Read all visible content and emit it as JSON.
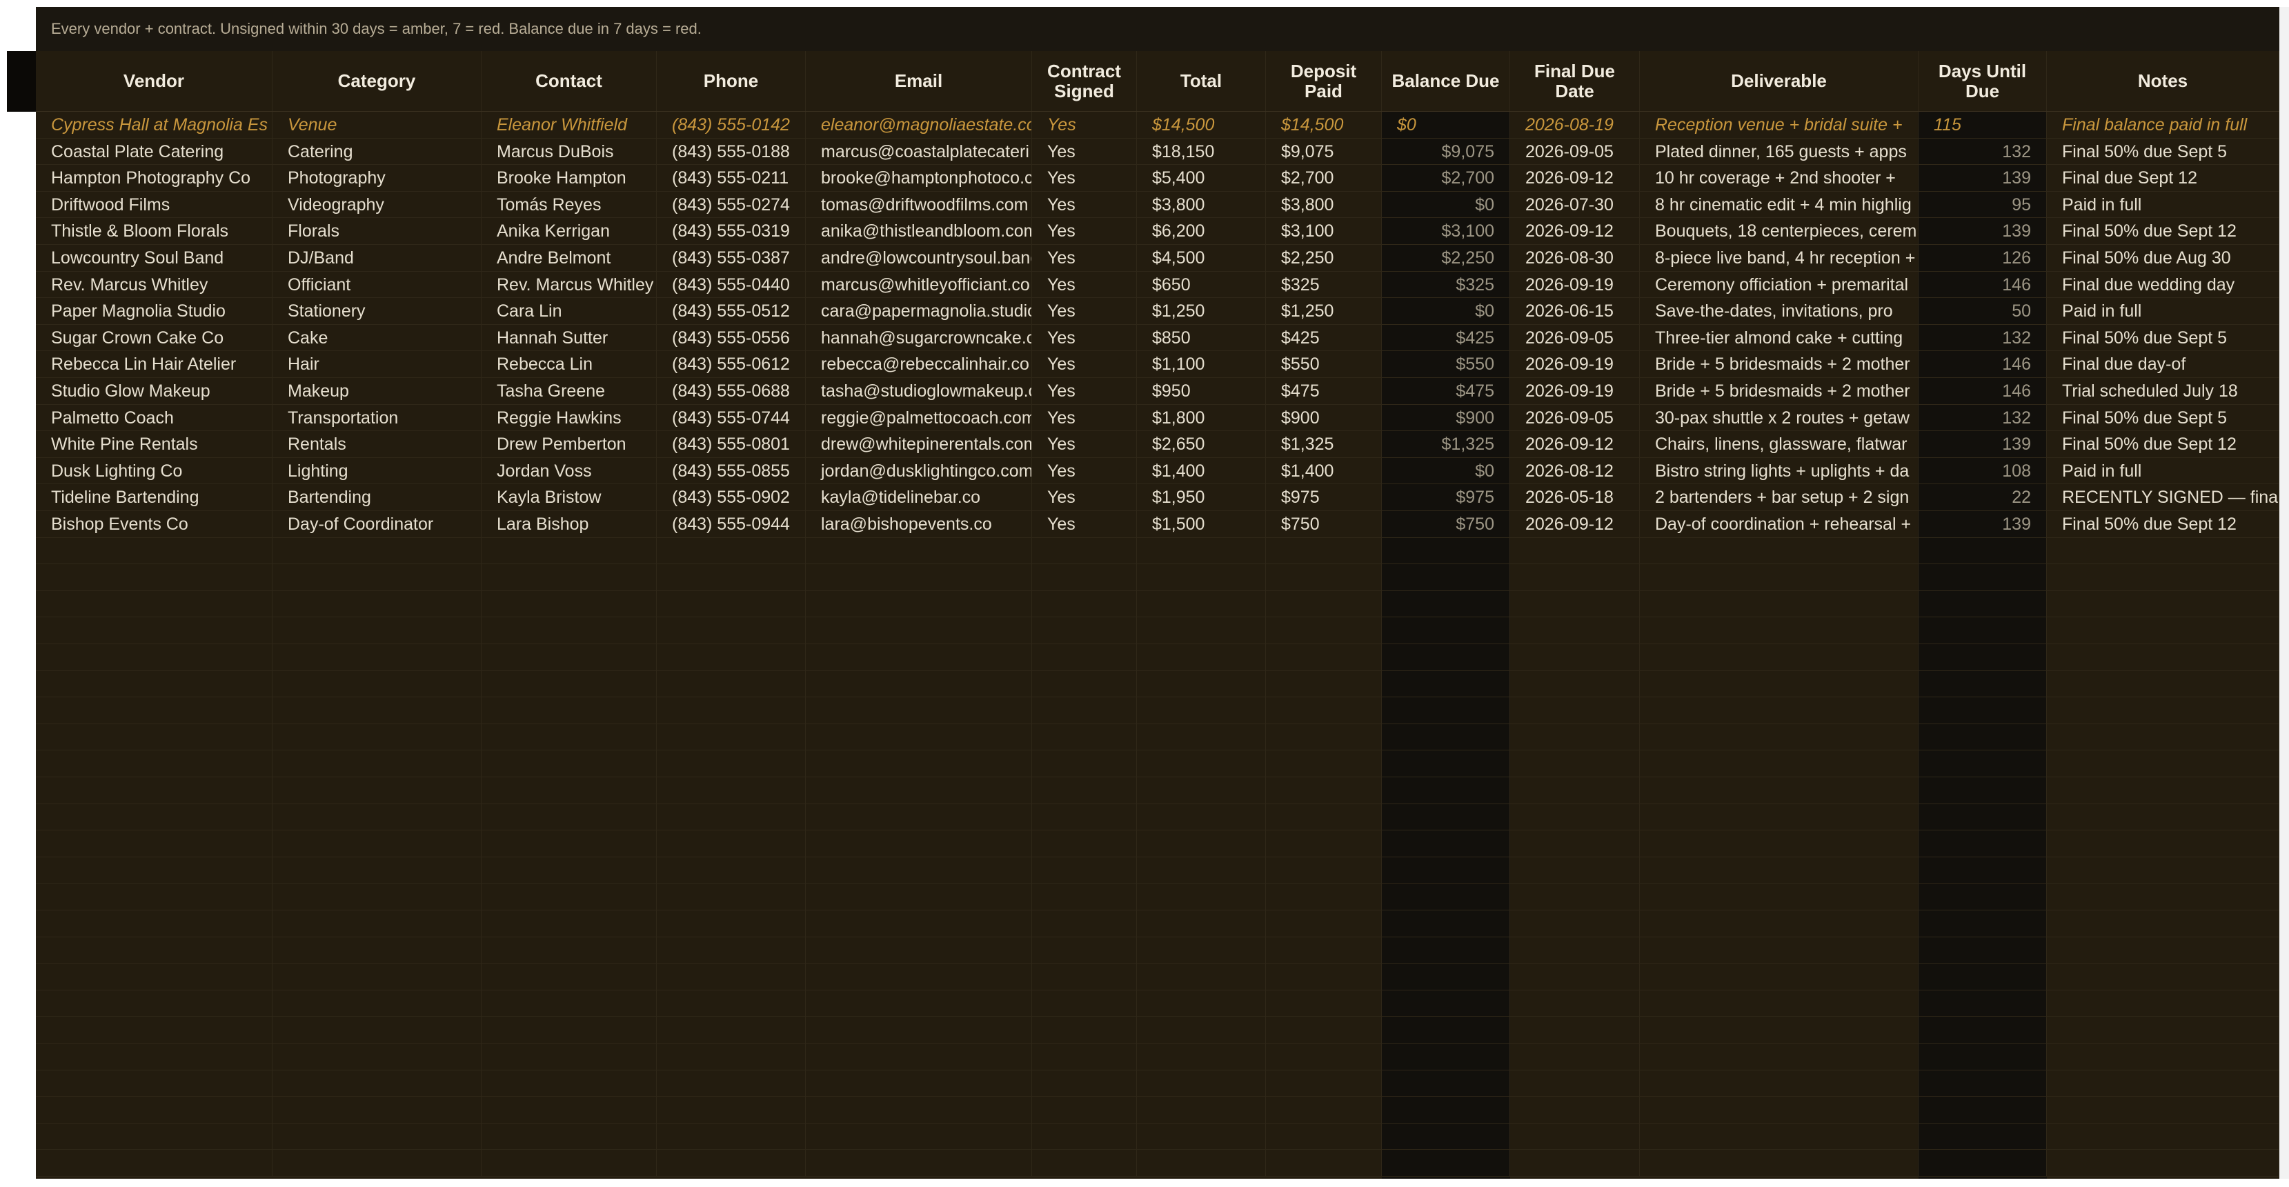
{
  "banner": "Every vendor + contract. Unsigned within 30 days = amber, 7 = red. Balance due in 7 days = red.",
  "columns": [
    {
      "label": "Vendor"
    },
    {
      "label": "Category"
    },
    {
      "label": "Contact"
    },
    {
      "label": "Phone"
    },
    {
      "label": "Email"
    },
    {
      "label": "Contract\nSigned"
    },
    {
      "label": "Total"
    },
    {
      "label": "Deposit Paid"
    },
    {
      "label": "Balance Due"
    },
    {
      "label": "Final Due Date"
    },
    {
      "label": "Deliverable"
    },
    {
      "label": "Days Until\nDue"
    },
    {
      "label": "Notes"
    }
  ],
  "rows": [
    {
      "vendor": "Cypress Hall at Magnolia Es",
      "category": "Venue",
      "contact": "Eleanor Whitfield",
      "phone": "(843) 555-0142",
      "email": "eleanor@magnoliaestate.co",
      "signed": "Yes",
      "total": "$14,500",
      "deposit": "$14,500",
      "balance": "$0",
      "due_date": "2026-08-19",
      "deliverable": "Reception venue + bridal suite +",
      "days": "115",
      "notes": "Final balance paid in full",
      "featured": true
    },
    {
      "vendor": "Coastal Plate Catering",
      "category": "Catering",
      "contact": "Marcus DuBois",
      "phone": "(843) 555-0188",
      "email": "marcus@coastalplatecateri",
      "signed": "Yes",
      "total": "$18,150",
      "deposit": "$9,075",
      "balance": "$9,075",
      "due_date": "2026-09-05",
      "deliverable": "Plated dinner, 165 guests + apps",
      "days": "132",
      "notes": "Final 50% due Sept 5"
    },
    {
      "vendor": "Hampton Photography Co",
      "category": "Photography",
      "contact": "Brooke Hampton",
      "phone": "(843) 555-0211",
      "email": "brooke@hamptonphotoco.c",
      "signed": "Yes",
      "total": "$5,400",
      "deposit": "$2,700",
      "balance": "$2,700",
      "due_date": "2026-09-12",
      "deliverable": "10 hr coverage + 2nd shooter +",
      "days": "139",
      "notes": "Final due Sept 12"
    },
    {
      "vendor": "Driftwood Films",
      "category": "Videography",
      "contact": "Tomás Reyes",
      "phone": "(843) 555-0274",
      "email": "tomas@driftwoodfilms.com",
      "signed": "Yes",
      "total": "$3,800",
      "deposit": "$3,800",
      "balance": "$0",
      "due_date": "2026-07-30",
      "deliverable": "8 hr cinematic edit + 4 min highlig",
      "days": "95",
      "notes": "Paid in full"
    },
    {
      "vendor": "Thistle & Bloom Florals",
      "category": "Florals",
      "contact": "Anika Kerrigan",
      "phone": "(843) 555-0319",
      "email": "anika@thistleandbloom.com",
      "signed": "Yes",
      "total": "$6,200",
      "deposit": "$3,100",
      "balance": "$3,100",
      "due_date": "2026-09-12",
      "deliverable": "Bouquets, 18 centerpieces, cerem",
      "days": "139",
      "notes": "Final 50% due Sept 12"
    },
    {
      "vendor": "Lowcountry Soul Band",
      "category": "DJ/Band",
      "contact": "Andre Belmont",
      "phone": "(843) 555-0387",
      "email": "andre@lowcountrysoul.banc",
      "signed": "Yes",
      "total": "$4,500",
      "deposit": "$2,250",
      "balance": "$2,250",
      "due_date": "2026-08-30",
      "deliverable": "8-piece live band, 4 hr reception +",
      "days": "126",
      "notes": "Final 50% due Aug 30"
    },
    {
      "vendor": "Rev. Marcus Whitley",
      "category": "Officiant",
      "contact": "Rev. Marcus Whitley",
      "phone": "(843) 555-0440",
      "email": "marcus@whitleyofficiant.co",
      "signed": "Yes",
      "total": "$650",
      "deposit": "$325",
      "balance": "$325",
      "due_date": "2026-09-19",
      "deliverable": "Ceremony officiation + premarital",
      "days": "146",
      "notes": "Final due wedding day"
    },
    {
      "vendor": "Paper Magnolia Studio",
      "category": "Stationery",
      "contact": "Cara Lin",
      "phone": "(843) 555-0512",
      "email": "cara@papermagnolia.studio",
      "signed": "Yes",
      "total": "$1,250",
      "deposit": "$1,250",
      "balance": "$0",
      "due_date": "2026-06-15",
      "deliverable": "Save-the-dates, invitations, pro",
      "days": "50",
      "notes": "Paid in full"
    },
    {
      "vendor": "Sugar Crown Cake Co",
      "category": "Cake",
      "contact": "Hannah Sutter",
      "phone": "(843) 555-0556",
      "email": "hannah@sugarcrowncake.c",
      "signed": "Yes",
      "total": "$850",
      "deposit": "$425",
      "balance": "$425",
      "due_date": "2026-09-05",
      "deliverable": "Three-tier almond cake + cutting",
      "days": "132",
      "notes": "Final 50% due Sept 5"
    },
    {
      "vendor": "Rebecca Lin Hair Atelier",
      "category": "Hair",
      "contact": "Rebecca Lin",
      "phone": "(843) 555-0612",
      "email": "rebecca@rebeccalinhair.co",
      "signed": "Yes",
      "total": "$1,100",
      "deposit": "$550",
      "balance": "$550",
      "due_date": "2026-09-19",
      "deliverable": "Bride + 5 bridesmaids + 2 mother",
      "days": "146",
      "notes": "Final due day-of"
    },
    {
      "vendor": "Studio Glow Makeup",
      "category": "Makeup",
      "contact": "Tasha Greene",
      "phone": "(843) 555-0688",
      "email": "tasha@studioglowmakeup.c",
      "signed": "Yes",
      "total": "$950",
      "deposit": "$475",
      "balance": "$475",
      "due_date": "2026-09-19",
      "deliverable": "Bride + 5 bridesmaids + 2 mother",
      "days": "146",
      "notes": "Trial scheduled July 18"
    },
    {
      "vendor": "Palmetto Coach",
      "category": "Transportation",
      "contact": "Reggie Hawkins",
      "phone": "(843) 555-0744",
      "email": "reggie@palmettocoach.com",
      "signed": "Yes",
      "total": "$1,800",
      "deposit": "$900",
      "balance": "$900",
      "due_date": "2026-09-05",
      "deliverable": "30-pax shuttle x 2 routes + getaw",
      "days": "132",
      "notes": "Final 50% due Sept 5"
    },
    {
      "vendor": "White Pine Rentals",
      "category": "Rentals",
      "contact": "Drew Pemberton",
      "phone": "(843) 555-0801",
      "email": "drew@whitepinerentals.com",
      "signed": "Yes",
      "total": "$2,650",
      "deposit": "$1,325",
      "balance": "$1,325",
      "due_date": "2026-09-12",
      "deliverable": "Chairs, linens, glassware, flatwar",
      "days": "139",
      "notes": "Final 50% due Sept 12"
    },
    {
      "vendor": "Dusk Lighting Co",
      "category": "Lighting",
      "contact": "Jordan Voss",
      "phone": "(843) 555-0855",
      "email": "jordan@dusklightingco.com",
      "signed": "Yes",
      "total": "$1,400",
      "deposit": "$1,400",
      "balance": "$0",
      "due_date": "2026-08-12",
      "deliverable": "Bistro string lights + uplights + da",
      "days": "108",
      "notes": "Paid in full"
    },
    {
      "vendor": "Tideline Bartending",
      "category": "Bartending",
      "contact": "Kayla Bristow",
      "phone": "(843) 555-0902",
      "email": "kayla@tidelinebar.co",
      "signed": "Yes",
      "total": "$1,950",
      "deposit": "$975",
      "balance": "$975",
      "due_date": "2026-05-18",
      "deliverable": "2 bartenders + bar setup + 2 sign",
      "days": "22",
      "notes": "RECENTLY SIGNED — fina"
    },
    {
      "vendor": "Bishop Events Co",
      "category": "Day-of Coordinator",
      "contact": "Lara Bishop",
      "phone": "(843) 555-0944",
      "email": "lara@bishopevents.co",
      "signed": "Yes",
      "total": "$1,500",
      "deposit": "$750",
      "balance": "$750",
      "due_date": "2026-09-12",
      "deliverable": "Day-of coordination + rehearsal +",
      "days": "139",
      "notes": "Final 50% due Sept 12"
    }
  ]
}
